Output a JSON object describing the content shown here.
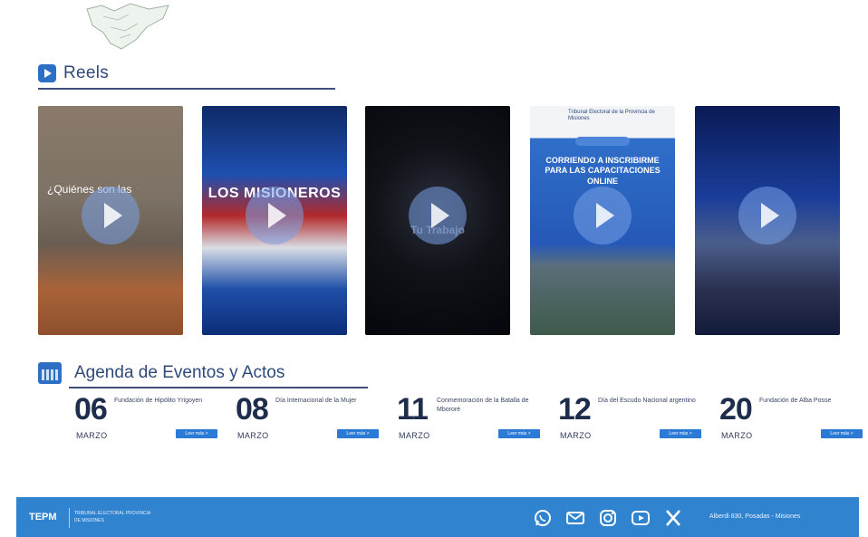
{
  "reels": {
    "title": "Reels",
    "items": [
      {
        "caption": "¿Quiénes son las"
      },
      {
        "caption": "LOS MISIONEROS"
      },
      {
        "caption": "Tu Trabajo"
      },
      {
        "top_text": "Tribunal Electoral de la Provincia de Misiones",
        "caption": "CORRIENDO A INSCRIBIRME PARA LAS CAPACITACIONES ONLINE"
      },
      {
        "caption": ""
      }
    ]
  },
  "agenda": {
    "title": "Agenda de Eventos y Actos",
    "read_more_label": "Leer más >",
    "events": [
      {
        "day": "06",
        "name": "Fundación de Hipólito Yrigoyen",
        "month": "MARZO"
      },
      {
        "day": "08",
        "name": "Día Internacional de la Mujer",
        "month": "MARZO"
      },
      {
        "day": "11",
        "name": "Conmemoración de la Batalla de Mbororé",
        "month": "MARZO"
      },
      {
        "day": "12",
        "name": "Día del Escudo Nacional argentino",
        "month": "MARZO"
      },
      {
        "day": "20",
        "name": "Fundación de Alba Posse",
        "month": "MARZO"
      }
    ]
  },
  "footer": {
    "brand": "TEPM",
    "brand_sub": "TRIBUNAL ELECTORAL PROVINCIA DE MISIONES",
    "social_icons": [
      "whatsapp-icon",
      "email-icon",
      "instagram-icon",
      "youtube-icon",
      "x-icon"
    ],
    "address": "Alberdi 830, Posadas - Misiones"
  },
  "colors": {
    "accent": "#2d6fc4",
    "footer_bg": "#2f83cf",
    "heading": "#2f4a7a"
  }
}
